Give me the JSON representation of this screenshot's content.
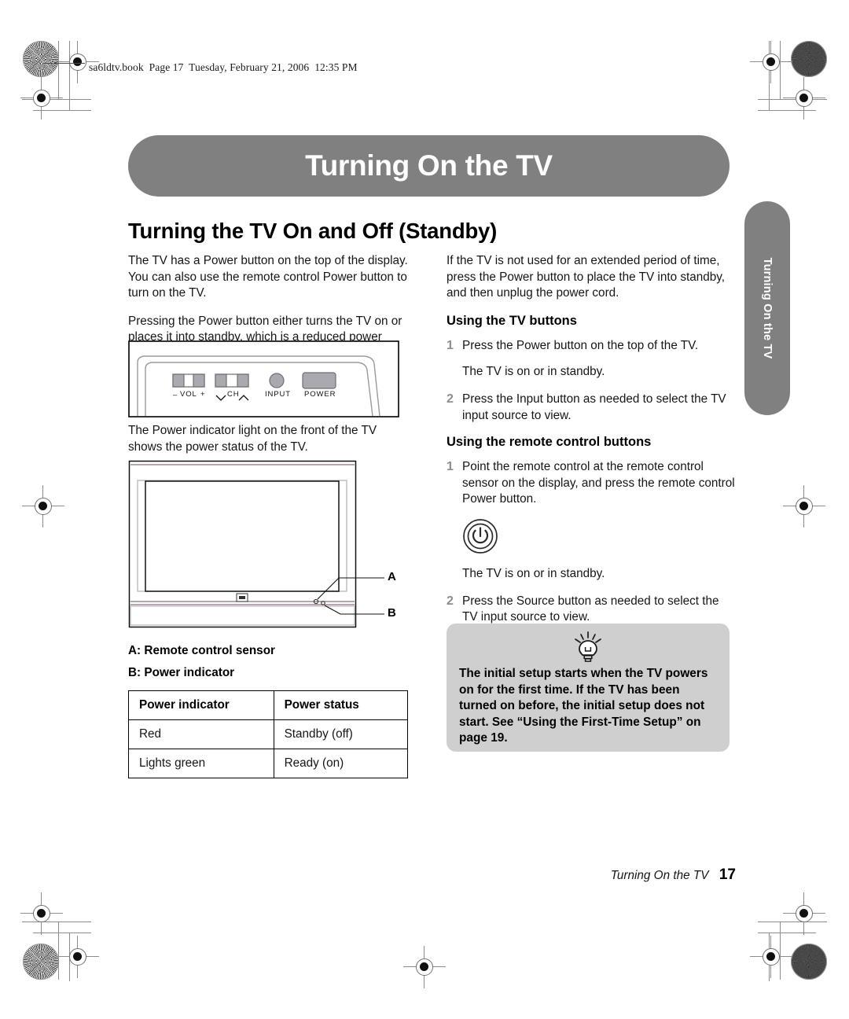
{
  "print_header": {
    "file_stamp": "sa6ldtv.book  Page 17  Tuesday, February 21, 2006  12:35 PM"
  },
  "chapter": {
    "banner_title": "Turning On the TV",
    "side_tab_label": "Turning On the TV"
  },
  "section": {
    "heading": "Turning the TV On and Off (Standby)"
  },
  "left_column": {
    "para1": "The TV has a Power button on the top of the display. You can also use the remote control Power button to turn on the TV.",
    "para2": "Pressing the Power button either turns the TV on or places it into standby, which is a reduced power state.",
    "para3": "The Power indicator light on the front of the TV shows the power status of the TV."
  },
  "right_column": {
    "para1": "If the TV is not used for an extended period of time, press the Power button to place the TV into standby, and then unplug the power cord.",
    "tv_buttons_heading": "Using the TV buttons",
    "tv_buttons_steps": [
      {
        "num": "1",
        "text": "Press the Power button on the top of the TV."
      },
      {
        "num": "2",
        "text": "Press the Input button as needed to select the TV input source to view."
      }
    ],
    "tv_buttons_note": "The TV is on or in standby.",
    "remote_heading": "Using the remote control buttons",
    "remote_steps": [
      {
        "num": "1",
        "text": "Point the remote control at the remote control sensor on the display, and press the remote control Power button."
      },
      {
        "num": "2",
        "text": "Press the Source button as needed to select the TV input source to view."
      }
    ],
    "remote_note": "The TV is on or in standby."
  },
  "tip": {
    "icon": "lightbulb-icon",
    "text": "The initial setup starts when the TV powers on for the first time. If the TV has been turned on before, the initial setup does not start. See “Using the First-Time Setup” on page 19."
  },
  "figure_top_panel": {
    "labels": {
      "vol_minus": "–",
      "vol": "VOL",
      "vol_plus": "+",
      "ch": "CH",
      "input": "INPUT",
      "power": "POWER"
    }
  },
  "figure_front_view": {
    "callout_a": "A",
    "callout_b": "B"
  },
  "legend": {
    "line_a": "A: Remote control sensor",
    "line_b": "B: Power indicator"
  },
  "power_table": {
    "headers": [
      "Power indicator",
      "Power status"
    ],
    "rows": [
      [
        "Red",
        "Standby (off)"
      ],
      [
        "Lights green",
        "Ready (on)"
      ]
    ]
  },
  "footer": {
    "title": "Turning On the TV",
    "page_number": "17"
  },
  "colors": {
    "banner_gray": "#808080",
    "tip_gray": "#cfcfcf",
    "step_number_gray": "#8e8e8e",
    "text_black": "#161616"
  }
}
